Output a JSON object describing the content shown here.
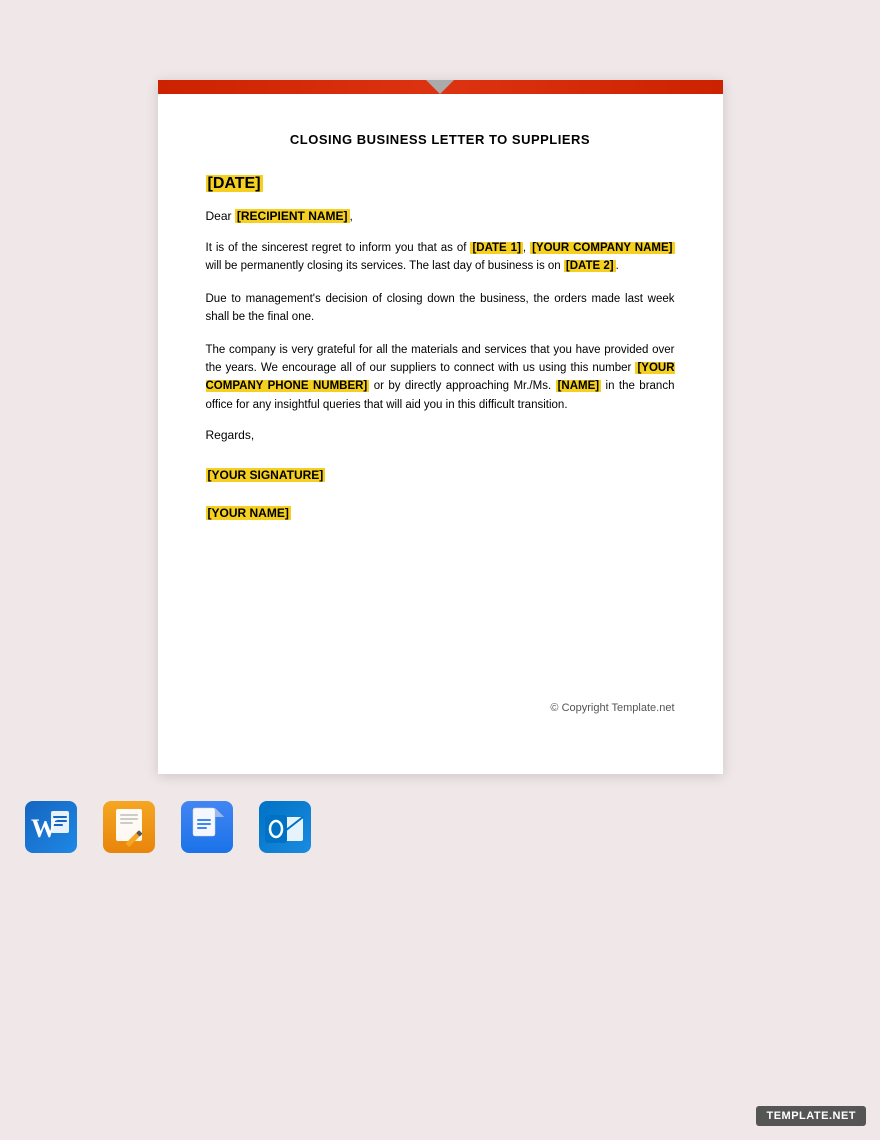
{
  "document": {
    "title": "CLOSING BUSINESS LETTER TO SUPPLIERS",
    "date_placeholder": "[DATE]",
    "salutation_prefix": "Dear",
    "recipient_placeholder": "[RECIPIENT NAME]",
    "paragraph1": "It is of the sincerest regret to inform you that as of",
    "date1_placeholder": "[DATE 1]",
    "company_name_placeholder": "[YOUR COMPANY NAME]",
    "paragraph1_mid": "will be permanently closing its services. The last day of business is on",
    "date2_placeholder": "[DATE 2]",
    "paragraph2": "Due to management's decision of closing down the business, the orders made last week shall be the final one.",
    "paragraph3a": "The company is very grateful for all the materials and services that you have provided over the years. We encourage all of our suppliers to connect with us using this  number",
    "phone_placeholder": "[YOUR COMPANY PHONE NUMBER]",
    "paragraph3b": "or by directly approaching Mr./Ms.",
    "name_placeholder": "[NAME]",
    "paragraph3c": "in the branch office for any insightful queries that will aid you in this difficult transition.",
    "regards": "Regards,",
    "signature_placeholder": "[YOUR SIGNATURE]",
    "name_placeholder2": "[YOUR NAME]",
    "copyright": "© Copyright Template.net"
  },
  "app_icons": [
    {
      "name": "Microsoft Word",
      "type": "word"
    },
    {
      "name": "Apple Pages",
      "type": "pages"
    },
    {
      "name": "Google Docs",
      "type": "gdocs"
    },
    {
      "name": "Microsoft Outlook",
      "type": "outlook"
    }
  ],
  "template_badge": "TEMPLATE.NET"
}
